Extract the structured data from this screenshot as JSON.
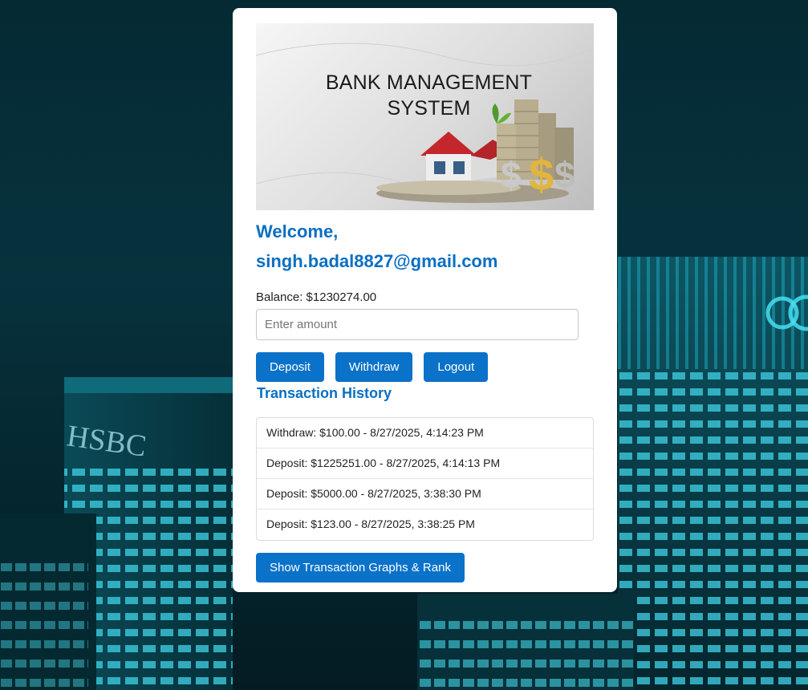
{
  "banner": {
    "line1": "BANK MANAGEMENT",
    "line2": "SYSTEM"
  },
  "welcome": {
    "greeting": "Welcome,",
    "email": "singh.badal8827@gmail.com"
  },
  "balance": {
    "text": "Balance: $1230274.00"
  },
  "amount": {
    "placeholder": "Enter amount",
    "value": ""
  },
  "actions": {
    "deposit": "Deposit",
    "withdraw": "Withdraw",
    "logout": "Logout"
  },
  "history": {
    "title": "Transaction History",
    "items": [
      "Withdraw: $100.00 - 8/27/2025, 4:14:23 PM",
      "Deposit: $1225251.00 - 8/27/2025, 4:14:13 PM",
      "Deposit: $5000.00 - 8/27/2025, 3:38:30 PM",
      "Deposit: $123.00 - 8/27/2025, 3:38:25 PM"
    ]
  },
  "graphs_button": "Show Transaction Graphs & Rank",
  "background_sign": "HSBC",
  "colors": {
    "accent": "#0b72c9",
    "heading": "#0b6fc2",
    "background": "#04232c",
    "building_glow": "#38d7ec"
  }
}
